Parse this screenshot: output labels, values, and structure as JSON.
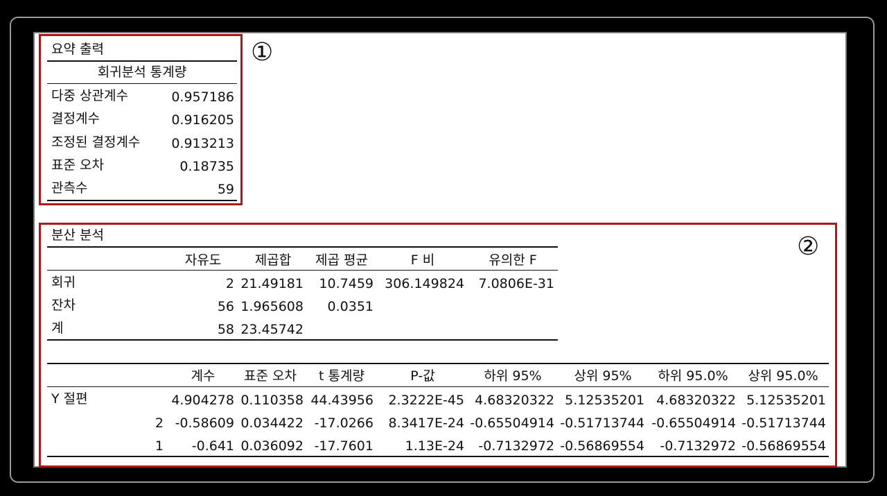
{
  "summary": {
    "title": "요약 출력",
    "section_header": "회귀분석 통계량",
    "rows": [
      {
        "label": "다중 상관계수",
        "value": "0.957186"
      },
      {
        "label": "결정계수",
        "value": "0.916205"
      },
      {
        "label": "조정된 결정계수",
        "value": "0.913213"
      },
      {
        "label": "표준 오차",
        "value": "0.18735"
      },
      {
        "label": "관측수",
        "value": "59"
      }
    ],
    "marker": "①"
  },
  "anova": {
    "title": "분산 분석",
    "marker": "②",
    "headers": [
      "자유도",
      "제곱합",
      "제곱 평균",
      "F 비",
      "유의한 F"
    ],
    "rows": [
      {
        "label": "회귀",
        "cells": [
          "2",
          "21.49181",
          "10.7459",
          "306.149824",
          "7.0806E-31"
        ]
      },
      {
        "label": "잔차",
        "cells": [
          "56",
          "1.965608",
          "0.0351",
          "",
          ""
        ]
      },
      {
        "label": "계",
        "cells": [
          "58",
          "23.45742",
          "",
          "",
          ""
        ]
      }
    ]
  },
  "coefficients": {
    "headers": [
      "계수",
      "표준 오차",
      "t 통계량",
      "P-값",
      "하위 95%",
      "상위 95%",
      "하위 95.0%",
      "상위 95.0%"
    ],
    "rows": [
      {
        "label": "Y 절편",
        "cells": [
          "4.904278",
          "0.110358",
          "44.43956",
          "2.3222E-45",
          "4.68320322",
          "5.12535201",
          "4.68320322",
          "5.12535201"
        ]
      },
      {
        "label": "2",
        "cells": [
          "-0.58609",
          "0.034422",
          "-17.0266",
          "8.3417E-24",
          "-0.65504914",
          "-0.51713744",
          "-0.65504914",
          "-0.51713744"
        ]
      },
      {
        "label": "1",
        "cells": [
          "-0.641",
          "0.036092",
          "-17.7601",
          "1.13E-24",
          "-0.7132972",
          "-0.56869554",
          "-0.7132972",
          "-0.56869554"
        ]
      }
    ]
  }
}
